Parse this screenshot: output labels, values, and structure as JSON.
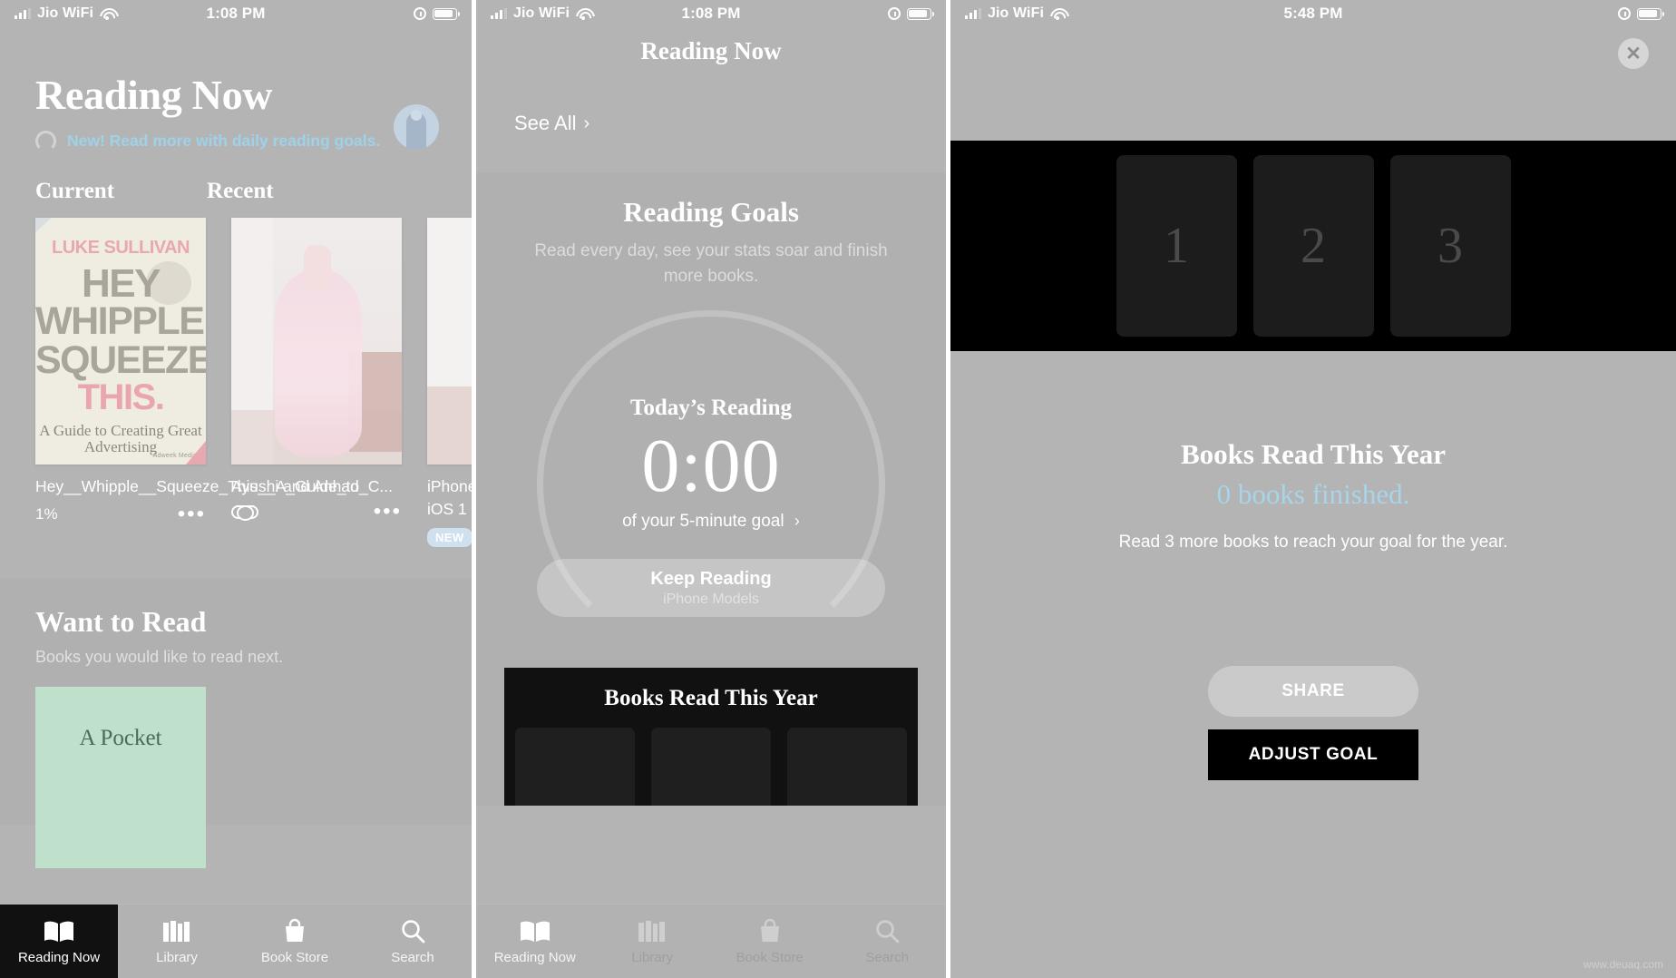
{
  "panel1": {
    "status": {
      "carrier": "Jio WiFi",
      "time": "1:08 PM"
    },
    "title": "Reading Now",
    "promo": "New! Read more with daily reading goals.",
    "sections": [
      {
        "heading": "Current"
      },
      {
        "heading": "Recent"
      }
    ],
    "books": [
      {
        "title": "Hey__Whipple__Squeeze_This__A_Guide_to_C...",
        "progress": "1%",
        "cover": {
          "author": "LUKE SULLIVAN",
          "line1": "HEY",
          "line2": "WHIPPLE,",
          "line3": "SQUEEZE",
          "line4": "THIS.",
          "subtitle": "A Guide to Creating Great Advertising",
          "publisher": "Adweek Media"
        }
      },
      {
        "title": "Ayushi and Anhad",
        "progress": ""
      },
      {
        "title": "iPhone",
        "title2": "iOS 1",
        "badge": "NEW"
      }
    ],
    "want_to_read": {
      "heading": "Want to Read",
      "subtitle": "Books you would like to read next.",
      "cover_text": "A Pocket"
    },
    "tabs": [
      {
        "label": "Reading Now",
        "icon": "book-icon"
      },
      {
        "label": "Library",
        "icon": "library-icon"
      },
      {
        "label": "Book Store",
        "icon": "bag-icon"
      },
      {
        "label": "Search",
        "icon": "search-icon"
      }
    ]
  },
  "panel2": {
    "status": {
      "carrier": "Jio WiFi",
      "time": "1:08 PM"
    },
    "nav_title": "Reading Now",
    "see_all": "See All",
    "goals": {
      "title": "Reading Goals",
      "subtitle": "Read every day, see your stats soar and finish more books.",
      "today_label": "Today’s Reading",
      "time": "0:00",
      "goal_text": "of your 5-minute goal"
    },
    "keep_reading": {
      "primary": "Keep Reading",
      "secondary": "iPhone Models"
    },
    "books_read_card": {
      "title": "Books Read This Year"
    },
    "tabs": [
      {
        "label": "Reading Now",
        "icon": "book-icon"
      },
      {
        "label": "Library",
        "icon": "library-icon"
      },
      {
        "label": "Book Store",
        "icon": "bag-icon"
      },
      {
        "label": "Search",
        "icon": "search-icon"
      }
    ]
  },
  "panel3": {
    "status": {
      "carrier": "Jio WiFi",
      "time": "5:48 PM"
    },
    "close_icon": "close-icon",
    "slots": [
      "1",
      "2",
      "3"
    ],
    "heading": "Books Read This Year",
    "count_line": "0 books finished.",
    "note": "Read 3 more books to reach your goal for the year.",
    "share_label": "SHARE",
    "adjust_label": "ADJUST GOAL"
  },
  "watermark": "www.deuaq.com",
  "colors": {
    "accent_blue": "#9fd2e8",
    "panel_bg": "#b4b4b4",
    "card_black": "#111111"
  }
}
